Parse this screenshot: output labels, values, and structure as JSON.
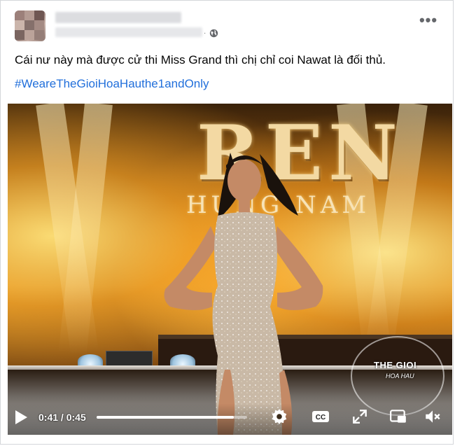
{
  "post": {
    "text": "Cái nư này mà được cử thi Miss Grand thì chị chỉ coi Nawat là đối thủ.",
    "hashtag": "#WeareTheGioiHoaHauthe1andOnly",
    "dot": "·",
    "more": "•••"
  },
  "video": {
    "logo_main": "REN",
    "logo_sub": "HƯNG NAM",
    "watermark_line1": "THE GIOI",
    "watermark_line2": "HOA HAU",
    "time_current": "0:41",
    "time_separator": " / ",
    "time_total": "0:45",
    "progress": 0.911
  },
  "icons": [
    "globe-icon",
    "more-icon",
    "play-icon",
    "settings-icon",
    "cc-icon",
    "fullscreen-icon",
    "pip-icon",
    "volume-muted-icon"
  ],
  "colors": {
    "hashtag": "#216fdb",
    "text": "#050505",
    "meta": "#65676b"
  }
}
